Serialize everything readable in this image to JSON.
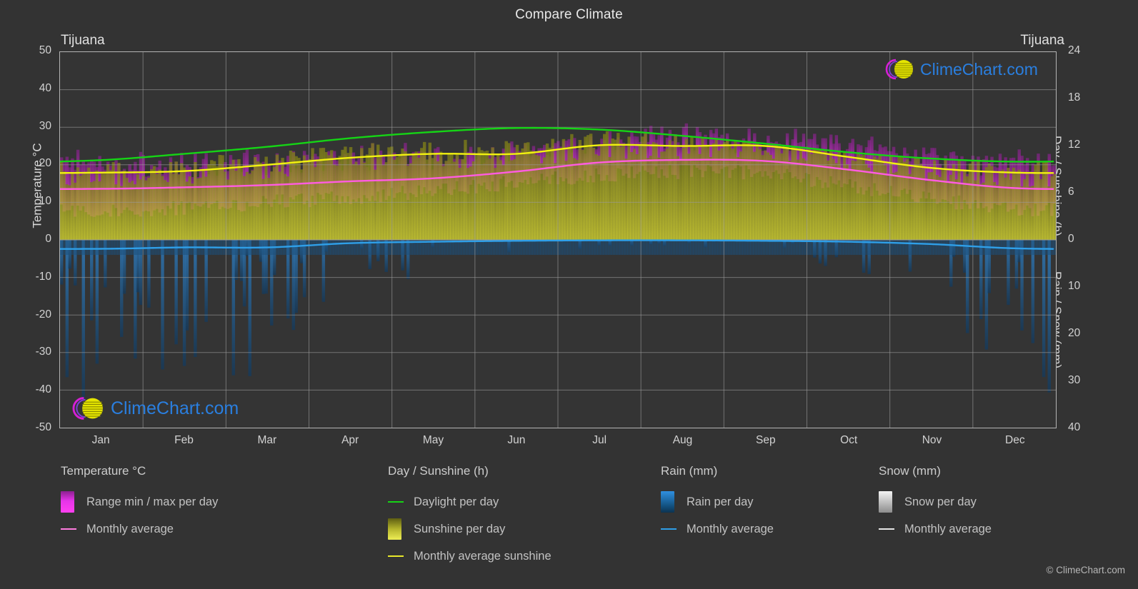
{
  "header": {
    "title": "Compare Climate",
    "left_city": "Tijuana",
    "right_city": "Tijuana"
  },
  "axes": {
    "left_title": "Temperature °C",
    "right_title_top": "Day / Sunshine (h)",
    "right_title_bottom": "Rain / Snow (mm)",
    "left_ticks": [
      "50",
      "40",
      "30",
      "20",
      "10",
      "0",
      "-10",
      "-20",
      "-30",
      "-40",
      "-50"
    ],
    "right_ticks_top": [
      "24",
      "18",
      "12",
      "6",
      "0"
    ],
    "right_ticks_bottom": [
      "0",
      "10",
      "20",
      "30",
      "40"
    ],
    "months": [
      "Jan",
      "Feb",
      "Mar",
      "Apr",
      "May",
      "Jun",
      "Jul",
      "Aug",
      "Sep",
      "Oct",
      "Nov",
      "Dec"
    ]
  },
  "legend": {
    "temperature": {
      "heading": "Temperature °C",
      "items": [
        {
          "label": "Range min / max per day",
          "swatch": "gradient-magenta",
          "type": "box"
        },
        {
          "label": "Monthly average",
          "swatch": "#ff7ce0",
          "type": "line"
        }
      ]
    },
    "day_sunshine": {
      "heading": "Day / Sunshine (h)",
      "items": [
        {
          "label": "Daylight per day",
          "swatch": "#15d415",
          "type": "line"
        },
        {
          "label": "Sunshine per day",
          "swatch": "gradient-yellow",
          "type": "box"
        },
        {
          "label": "Monthly average sunshine",
          "swatch": "#e8e82a",
          "type": "line"
        }
      ]
    },
    "rain": {
      "heading": "Rain (mm)",
      "items": [
        {
          "label": "Rain per day",
          "swatch": "gradient-blue",
          "type": "box"
        },
        {
          "label": "Monthly average",
          "swatch": "#2f9fe8",
          "type": "line"
        }
      ]
    },
    "snow": {
      "heading": "Snow (mm)",
      "items": [
        {
          "label": "Snow per day",
          "swatch": "gradient-white",
          "type": "box"
        },
        {
          "label": "Monthly average",
          "swatch": "#e6e6e6",
          "type": "line"
        }
      ]
    }
  },
  "logo": {
    "text": "ClimeChart.com"
  },
  "copyright": "© ClimeChart.com",
  "colors": {
    "background": "#333333",
    "plot_background": "#343434",
    "grid": "#8f8f8f",
    "daylight": "#15d415",
    "sunshine_avg": "#f2f20f",
    "temp_avg": "#ff5ce0",
    "rain_avg": "#2f9fe8",
    "temp_range": "#c51fd0",
    "sunshine_band": "#a5a52c",
    "rain_band": "#1d4f78",
    "logo_blue": "#2a7fe0",
    "logo_magenta": "#d61fd6",
    "logo_yellow": "#e5e500"
  },
  "chart_data": {
    "type": "area",
    "title": "Compare Climate",
    "location": "Tijuana",
    "xlabel": "",
    "ylabel": "Temperature °C",
    "ylabel_right_top": "Day / Sunshine (h)",
    "ylabel_right_bottom": "Rain / Snow (mm)",
    "grid": true,
    "legend_position": "bottom",
    "ylim": [
      -50,
      50
    ],
    "ylim_right_day": [
      0,
      24
    ],
    "ylim_right_rain": [
      0,
      40
    ],
    "categories": [
      "Jan",
      "Feb",
      "Mar",
      "Apr",
      "May",
      "Jun",
      "Jul",
      "Aug",
      "Sep",
      "Oct",
      "Nov",
      "Dec"
    ],
    "series": [
      {
        "name": "Daylight per day",
        "unit": "h",
        "color": "#15d415",
        "values": [
          10.2,
          11.0,
          11.9,
          13.0,
          13.8,
          14.3,
          14.1,
          13.3,
          12.3,
          11.2,
          10.4,
          10.0
        ]
      },
      {
        "name": "Monthly average sunshine",
        "unit": "h",
        "color": "#f2f20f",
        "values": [
          8.6,
          8.8,
          9.6,
          10.5,
          11.0,
          11.0,
          12.1,
          12.0,
          12.0,
          10.6,
          9.2,
          8.6
        ]
      },
      {
        "name": "Temperature monthly average",
        "unit": "°C",
        "color": "#ff5ce0",
        "values": [
          13.6,
          14.0,
          14.6,
          15.6,
          16.4,
          18.2,
          20.6,
          21.3,
          21.0,
          18.7,
          15.9,
          13.8
        ]
      },
      {
        "name": "Temperature max per day (range top)",
        "unit": "°C",
        "color": "#c51fd0",
        "values": [
          19.5,
          19.6,
          20.0,
          21.0,
          21.5,
          23.0,
          25.5,
          26.5,
          26.0,
          24.0,
          21.5,
          19.5
        ]
      },
      {
        "name": "Temperature min per day (range bottom)",
        "unit": "°C",
        "color": "#c51fd0",
        "values": [
          8.0,
          8.6,
          10.0,
          11.4,
          13.2,
          15.3,
          17.3,
          18.2,
          17.5,
          14.5,
          10.8,
          8.4
        ]
      },
      {
        "name": "Rain monthly average",
        "unit": "mm",
        "color": "#2f9fe8",
        "values": [
          1.9,
          1.6,
          1.6,
          0.7,
          0.4,
          0.2,
          0.1,
          0.1,
          0.2,
          0.4,
          0.9,
          1.8
        ]
      },
      {
        "name": "Snow monthly average",
        "unit": "mm",
        "color": "#e6e6e6",
        "values": [
          0,
          0,
          0,
          0,
          0,
          0,
          0,
          0,
          0,
          0,
          0,
          0
        ]
      }
    ]
  }
}
